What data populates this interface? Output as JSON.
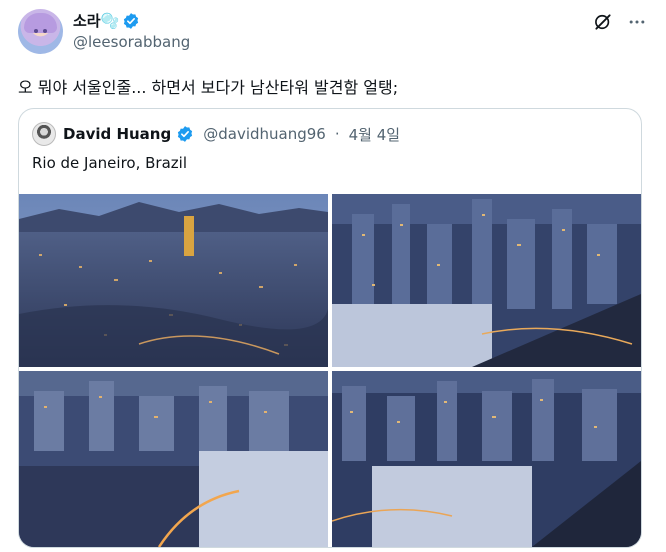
{
  "post": {
    "display_name": "소라🫧",
    "handle": "@leesorabbang",
    "text": "오 뭐야 서울인줄... 하면서 보다가 남산타워 발견함 얼탱;"
  },
  "quoted": {
    "display_name": "David Huang",
    "handle": "@davidhuang96",
    "separator": "·",
    "date": "4월 4일",
    "text": "Rio de Janeiro, Brazil"
  },
  "icons": {
    "verified": "verified-badge-icon",
    "grok": "grok-icon",
    "more": "more-icon"
  },
  "colors": {
    "verified_blue": "#1d9bf0",
    "text": "#0f1419",
    "secondary": "#536471",
    "border": "#cfd9de"
  }
}
